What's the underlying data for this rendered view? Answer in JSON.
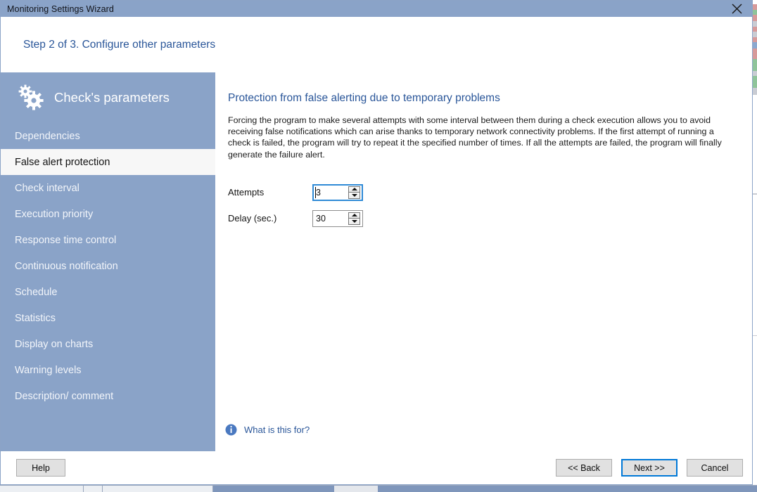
{
  "window": {
    "title": "Monitoring Settings Wizard",
    "close_icon": "close-icon"
  },
  "step_header": {
    "title": "Step 2 of 3. Configure other parameters"
  },
  "sidebar": {
    "icon": "gears-icon",
    "heading": "Check's parameters",
    "items": [
      {
        "label": "Dependencies",
        "selected": false
      },
      {
        "label": "False alert protection",
        "selected": true
      },
      {
        "label": "Check interval",
        "selected": false
      },
      {
        "label": "Execution priority",
        "selected": false
      },
      {
        "label": "Response time control",
        "selected": false
      },
      {
        "label": "Continuous notification",
        "selected": false
      },
      {
        "label": "Schedule",
        "selected": false
      },
      {
        "label": "Statistics",
        "selected": false
      },
      {
        "label": "Display on charts",
        "selected": false
      },
      {
        "label": "Warning levels",
        "selected": false
      },
      {
        "label": "Description/ comment",
        "selected": false
      }
    ]
  },
  "main": {
    "heading": "Protection from false alerting due to temporary problems",
    "paragraph": "Forcing the program to make several attempts with some interval between them during a check execution allows you to avoid receiving false notifications which can arise thanks to temporary network connectivity problems. If the first attempt of running a check is failed, the program will try to repeat it the specified number of times. If all the attempts are failed, the program will finally generate the failure alert.",
    "fields": [
      {
        "label": "Attempts",
        "value": "3",
        "focused": true
      },
      {
        "label": "Delay (sec.)",
        "value": "30",
        "focused": false
      }
    ],
    "help_link": {
      "icon": "info-icon",
      "text": "What is this for?"
    }
  },
  "footer": {
    "help_label": "Help",
    "back_label": "<< Back",
    "next_label": "Next >>",
    "cancel_label": "Cancel"
  },
  "colors": {
    "titlebar": "#8aa3c8",
    "sidebar": "#8aa3c8",
    "accent_text": "#2a5699",
    "selected_item_bg": "#f7f7f7",
    "focus_border": "#0078d7",
    "input_focus_border": "#2f8ad6"
  }
}
